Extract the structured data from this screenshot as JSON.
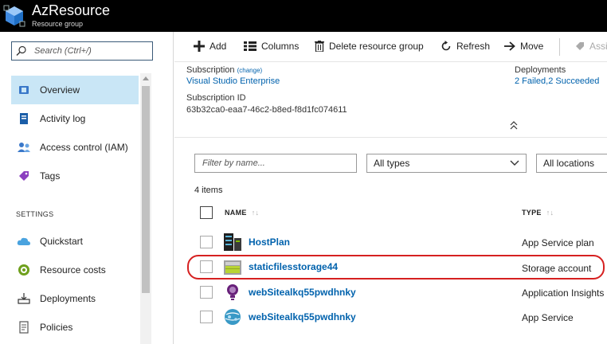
{
  "header": {
    "title": "AzResource",
    "subtitle": "Resource group",
    "logo_icon": "resource-group-cube-icon"
  },
  "search": {
    "placeholder": "Search (Ctrl+/)"
  },
  "sidebar": {
    "items": [
      {
        "label": "Overview",
        "icon": "overview-icon",
        "active": true
      },
      {
        "label": "Activity log",
        "icon": "activity-log-icon"
      },
      {
        "label": "Access control (IAM)",
        "icon": "iam-icon"
      },
      {
        "label": "Tags",
        "icon": "tag-icon"
      }
    ],
    "section_settings": "SETTINGS",
    "settings_items": [
      {
        "label": "Quickstart",
        "icon": "quickstart-cloud-icon"
      },
      {
        "label": "Resource costs",
        "icon": "resource-costs-icon"
      },
      {
        "label": "Deployments",
        "icon": "deployments-icon"
      },
      {
        "label": "Policies",
        "icon": "policies-icon"
      }
    ]
  },
  "toolbar": {
    "add": "Add",
    "columns": "Columns",
    "delete": "Delete resource group",
    "refresh": "Refresh",
    "move": "Move",
    "assign_partial": "Assi"
  },
  "essentials": {
    "subscription_label": "Subscription",
    "subscription_change": "(change)",
    "subscription_value": "Visual Studio Enterprise",
    "subscription_id_label": "Subscription ID",
    "subscription_id_value": "63b32ca0-eaa7-46c2-b8ed-f8d1fc074611",
    "deployments_label": "Deployments",
    "deployments_value": "2 Failed,2 Succeeded"
  },
  "filters": {
    "name_placeholder": "Filter by name...",
    "types_value": "All types",
    "locations_value": "All locations"
  },
  "items_count": "4 items",
  "table": {
    "col_name": "NAME",
    "col_type": "TYPE",
    "sort_glyph": "↑↓",
    "rows": [
      {
        "name": "HostPlan",
        "type": "App Service plan",
        "icon": "app-service-plan-icon"
      },
      {
        "name": "staticfilesstorage44",
        "type": "Storage account",
        "icon": "storage-account-icon"
      },
      {
        "name": "webSitealkq55pwdhnky",
        "type": "Application Insights",
        "icon": "application-insights-icon"
      },
      {
        "name": "webSitealkq55pwdhnky",
        "type": "App Service",
        "icon": "app-service-globe-icon"
      }
    ]
  },
  "colors": {
    "accent": "#0062ad",
    "active_nav": "#c9e6f6",
    "highlight": "#d62020"
  }
}
